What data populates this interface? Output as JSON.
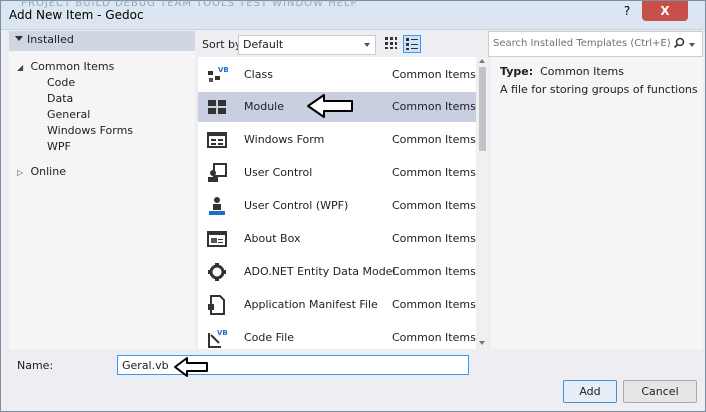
{
  "window": {
    "title": "Add New Item - Gedoc",
    "help_glyph": "?",
    "close_glyph": "X",
    "ghost_menu": "PROJECT   BUILD   DEBUG   TEAM   TOOLS   TEST   WINDOW   HELP"
  },
  "left_pane": {
    "installed_label": "Installed",
    "common_items_label": "Common Items",
    "children": [
      "Code",
      "Data",
      "General",
      "Windows Forms",
      "WPF"
    ],
    "online_label": "Online"
  },
  "sortbar": {
    "label": "Sort by:",
    "value": "Default"
  },
  "items": [
    {
      "name": "Class",
      "category": "Common Items",
      "icon": "class-icon"
    },
    {
      "name": "Module",
      "category": "Common Items",
      "icon": "module-icon"
    },
    {
      "name": "Windows Form",
      "category": "Common Items",
      "icon": "windows-form-icon"
    },
    {
      "name": "User Control",
      "category": "Common Items",
      "icon": "user-control-icon"
    },
    {
      "name": "User Control (WPF)",
      "category": "Common Items",
      "icon": "user-control-wpf-icon"
    },
    {
      "name": "About Box",
      "category": "Common Items",
      "icon": "about-box-icon"
    },
    {
      "name": "ADO.NET Entity Data Model",
      "category": "Common Items",
      "icon": "entity-data-model-icon"
    },
    {
      "name": "Application Manifest File",
      "category": "Common Items",
      "icon": "manifest-file-icon"
    },
    {
      "name": "Code File",
      "category": "Common Items",
      "icon": "code-file-icon"
    }
  ],
  "search": {
    "placeholder": "Search Installed Templates (Ctrl+E)"
  },
  "detail": {
    "type_label": "Type:",
    "type_value": "Common Items",
    "description": "A file for storing groups of functions"
  },
  "name_field": {
    "label": "Name:",
    "value": "Geral.vb"
  },
  "buttons": {
    "add": "Add",
    "cancel": "Cancel"
  },
  "colors": {
    "selection": "#c9cfe1",
    "accent": "#3399ff",
    "close": "#c7504b"
  }
}
